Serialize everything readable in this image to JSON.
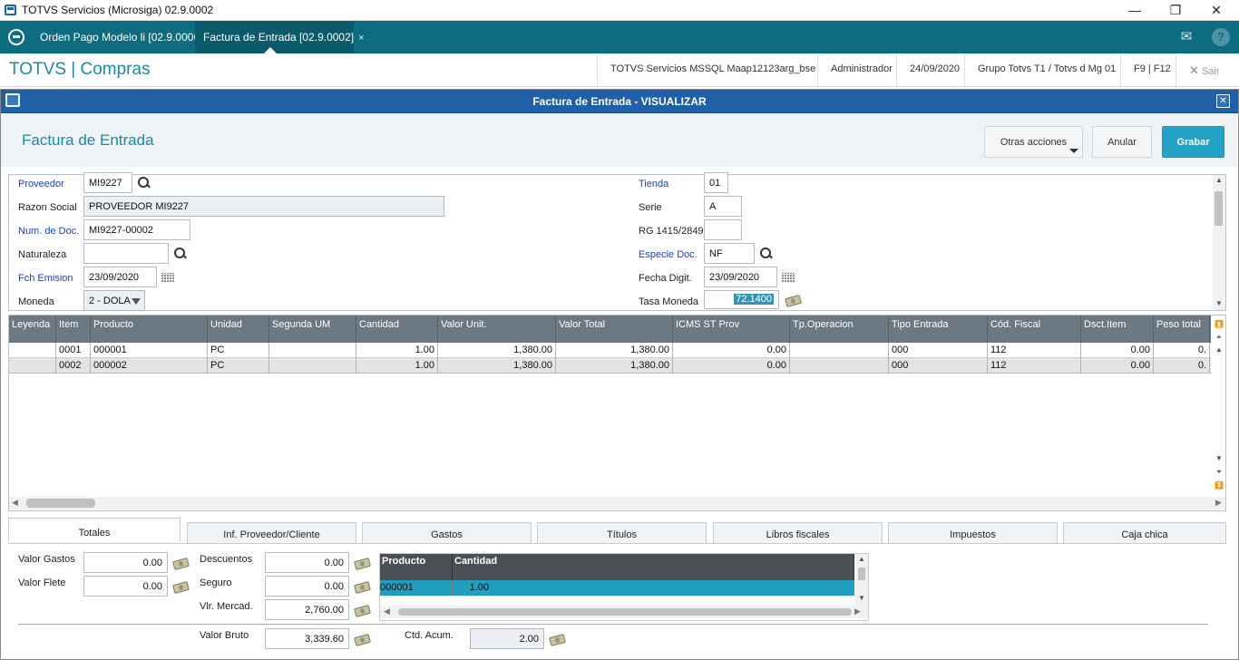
{
  "window": {
    "title": "TOTVS Servicios (Microsiga) 02.9.0002",
    "minimize": "—",
    "restore": "❐",
    "close": "✕"
  },
  "tabs": [
    {
      "label": "Orden Pago Modelo li [02.9.0006]",
      "close": "×"
    },
    {
      "label": "Factura de Entrada [02.9.0002]",
      "close": "×"
    }
  ],
  "header": {
    "brand": "TOTVS | Compras",
    "environment": "TOTVS Servicios MSSQL Maap12123arg_bse",
    "user": "Administrador",
    "date": "24/09/2020",
    "company": "Grupo Totvs T1 / Totvs d Mg 01",
    "keys": "F9 | F12",
    "exit_icon": "✕",
    "exit": "Sair"
  },
  "dialog": {
    "title": "Factura de Entrada - VISUALIZAR",
    "close": "✕"
  },
  "form": {
    "title": "Factura de Entrada",
    "actions": {
      "other": "Otras acciones",
      "cancel": "Anular",
      "save": "Grabar"
    },
    "fields": {
      "proveedor": {
        "label": "Proveedor",
        "value": "MI9227"
      },
      "razon_social": {
        "label": "Razon Social",
        "value": "PROVEEDOR MI9227"
      },
      "num_doc": {
        "label": "Num. de Doc.",
        "value": "MI9227-00002"
      },
      "naturaleza": {
        "label": "Naturaleza",
        "value": ""
      },
      "fch_emision": {
        "label": "Fch Emision",
        "value": "23/09/2020"
      },
      "moneda": {
        "label": "Moneda",
        "value": "2 - DOLA"
      },
      "tienda": {
        "label": "Tienda",
        "value": "01"
      },
      "serie": {
        "label": "Serie",
        "value": "A"
      },
      "rg": {
        "label": "RG 1415/2849",
        "value": ""
      },
      "especie_doc": {
        "label": "Especie Doc.",
        "value": "NF"
      },
      "fecha_digit": {
        "label": "Fecha Digit.",
        "value": "23/09/2020"
      },
      "tasa_moneda": {
        "label": "Tasa Moneda",
        "value": "72.1400"
      }
    }
  },
  "grid": {
    "columns": [
      "Leyenda",
      "Item",
      "Producto",
      "Unidad",
      "Segunda UM",
      "Cantidad",
      "Valor Unit.",
      "Valor Total",
      "ICMS ST Prov",
      "Tp.Operacion",
      "Tipo Entrada",
      "Cód. Fiscal",
      "Dsct.Item",
      "Peso total"
    ],
    "rows": [
      [
        "",
        "0001",
        "000001",
        "PC",
        "",
        "1.00",
        "1,380.00",
        "1,380.00",
        "0.00",
        "",
        "000",
        "112",
        "0.00",
        "0."
      ],
      [
        "",
        "0002",
        "000002",
        "PC",
        "",
        "1.00",
        "1,380.00",
        "1,380.00",
        "0.00",
        "",
        "000",
        "112",
        "0.00",
        "0."
      ]
    ]
  },
  "bottom_tabs": [
    "Totales",
    "Inf. Proveedor/Cliente",
    "Gastos",
    "Títulos",
    "Libros fiscales",
    "Impuestos",
    "Caja chica"
  ],
  "totals": {
    "valor_gastos": {
      "label": "Valor Gastos",
      "value": "0.00"
    },
    "valor_flete": {
      "label": "Valor Flete",
      "value": "0.00"
    },
    "descuentos": {
      "label": "Descuentos",
      "value": "0.00"
    },
    "seguro": {
      "label": "Seguro",
      "value": "0.00"
    },
    "vlr_mercad": {
      "label": "Vlr. Mercad.",
      "value": "2,760.00"
    },
    "valor_bruto": {
      "label": "Valor Bruto",
      "value": "3,339.60"
    },
    "ctd_acum": {
      "label": "Ctd. Acum.",
      "value": "2.00"
    }
  },
  "product_grid": {
    "columns": [
      "Producto",
      "Cantidad"
    ],
    "rows": [
      [
        "000001",
        "1.00"
      ]
    ]
  },
  "colors": {
    "teal": "#0e6c80",
    "dialog_blue": "#2060a8",
    "accent": "#24a3c9",
    "grid_header": "#6d7982"
  }
}
